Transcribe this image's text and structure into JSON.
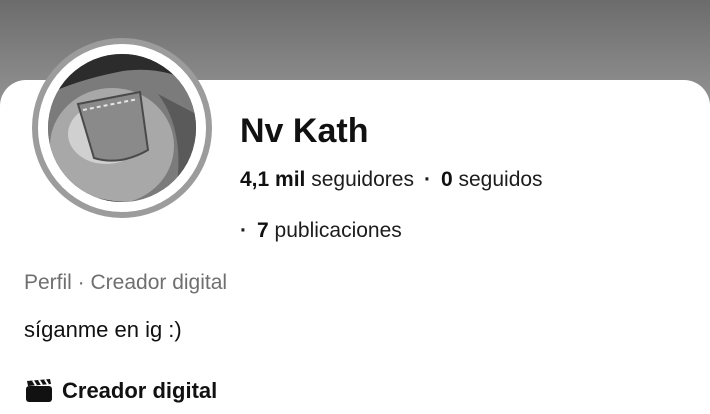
{
  "profile": {
    "name": "Nv Kath",
    "followers_count": "4,1 mil",
    "followers_label": "seguidores",
    "separator": "·",
    "following_count": "0",
    "following_label": "seguidos",
    "posts_count": "7",
    "posts_label": "publicaciones",
    "category_line": "Perfil · Creador digital",
    "bio": "síganme en ig :)",
    "creator_label": "Creador digital",
    "creator_icon": "clapperboard-icon"
  },
  "colors": {
    "cover": "#7a7a7a",
    "avatar_ring": "#9c9c9c",
    "text_primary": "#111111",
    "text_secondary": "#6f6f6f"
  }
}
